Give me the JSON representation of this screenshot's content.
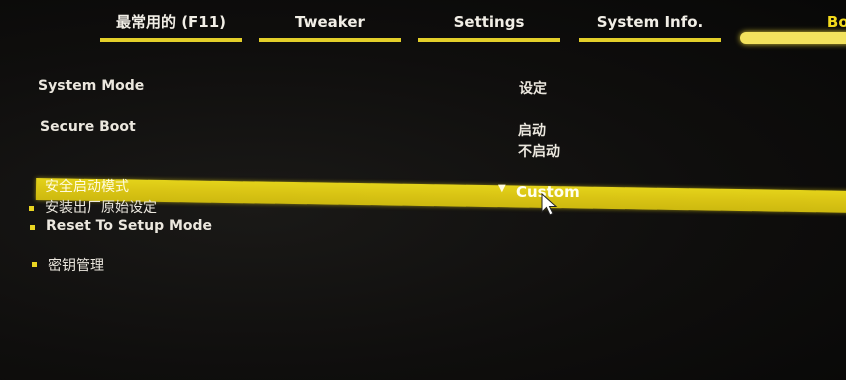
{
  "tabs": [
    {
      "label": "最常用的 (F11)"
    },
    {
      "label": "Tweaker"
    },
    {
      "label": "Settings"
    },
    {
      "label": "System Info."
    },
    {
      "label": "Boot"
    }
  ],
  "active_tab": "Boot",
  "settings": {
    "system_mode": {
      "label": "System Mode",
      "value": "设定"
    },
    "secure_boot": {
      "label": "Secure Boot",
      "value_1": "启动",
      "value_2": "不启动"
    },
    "secure_boot_mode": {
      "label": "安全启动模式",
      "value": "Custom"
    }
  },
  "actions": {
    "install_defaults": "安装出厂原始设定",
    "reset_setup_mode": "Reset To Setup Mode",
    "key_management": "密钥管理"
  },
  "colors": {
    "accent": "#e3cf2a",
    "background": "#0e0d0c",
    "text": "#ebe7de"
  }
}
